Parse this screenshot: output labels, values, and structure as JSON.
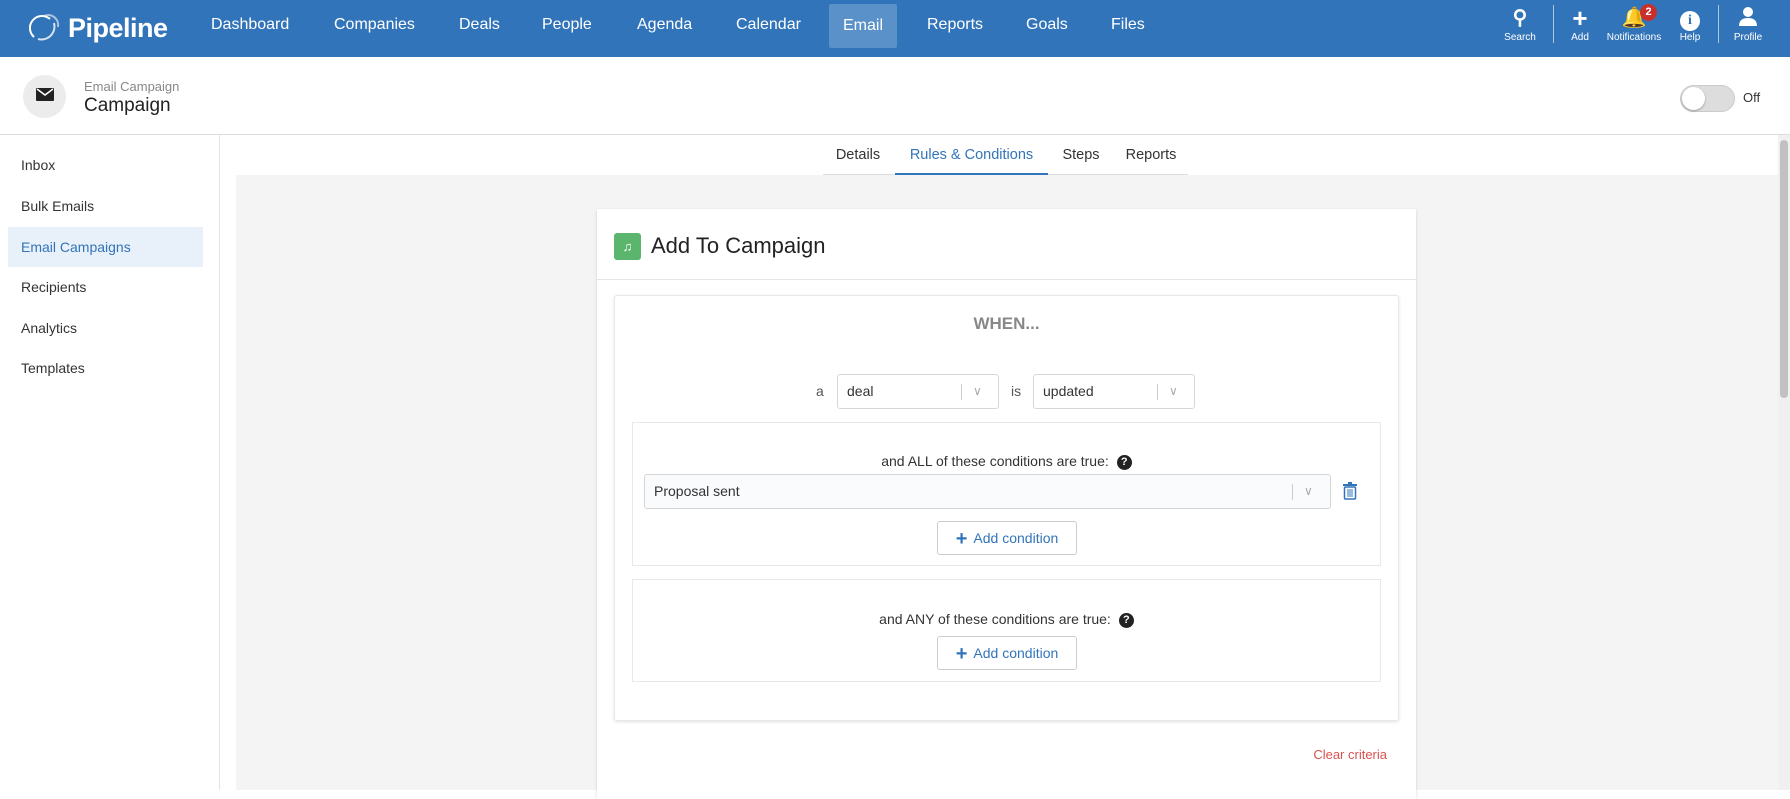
{
  "app": {
    "name": "Pipeline"
  },
  "nav": [
    "Dashboard",
    "Companies",
    "Deals",
    "People",
    "Agenda",
    "Calendar",
    "Email",
    "Reports",
    "Goals",
    "Files"
  ],
  "nav_active": "Email",
  "top_actions": {
    "search": "Search",
    "add": "Add",
    "notifications": "Notifications",
    "notifications_count": "2",
    "help": "Help",
    "profile": "Profile"
  },
  "header": {
    "subtitle": "Email Campaign",
    "title": "Campaign",
    "toggle_label": "Off",
    "toggle_on": false
  },
  "sidebar": [
    "Inbox",
    "Bulk Emails",
    "Email Campaigns",
    "Recipients",
    "Analytics",
    "Templates"
  ],
  "tabs": [
    "Details",
    "Rules & Conditions",
    "Steps",
    "Reports"
  ],
  "card": {
    "title": "Add To Campaign",
    "when": "WHEN...",
    "a_label": "a",
    "object_value": "deal",
    "is_label": "is",
    "event_value": "updated",
    "all_label": "and ALL of these conditions are true:",
    "all_conditions": [
      "Proposal sent"
    ],
    "any_label": "and ANY of these conditions are true:",
    "add_condition": "Add condition",
    "clear": "Clear criteria"
  },
  "colors": {
    "brand": "#3274b9",
    "accent_green": "#5cb56d",
    "danger": "#d9534f"
  }
}
